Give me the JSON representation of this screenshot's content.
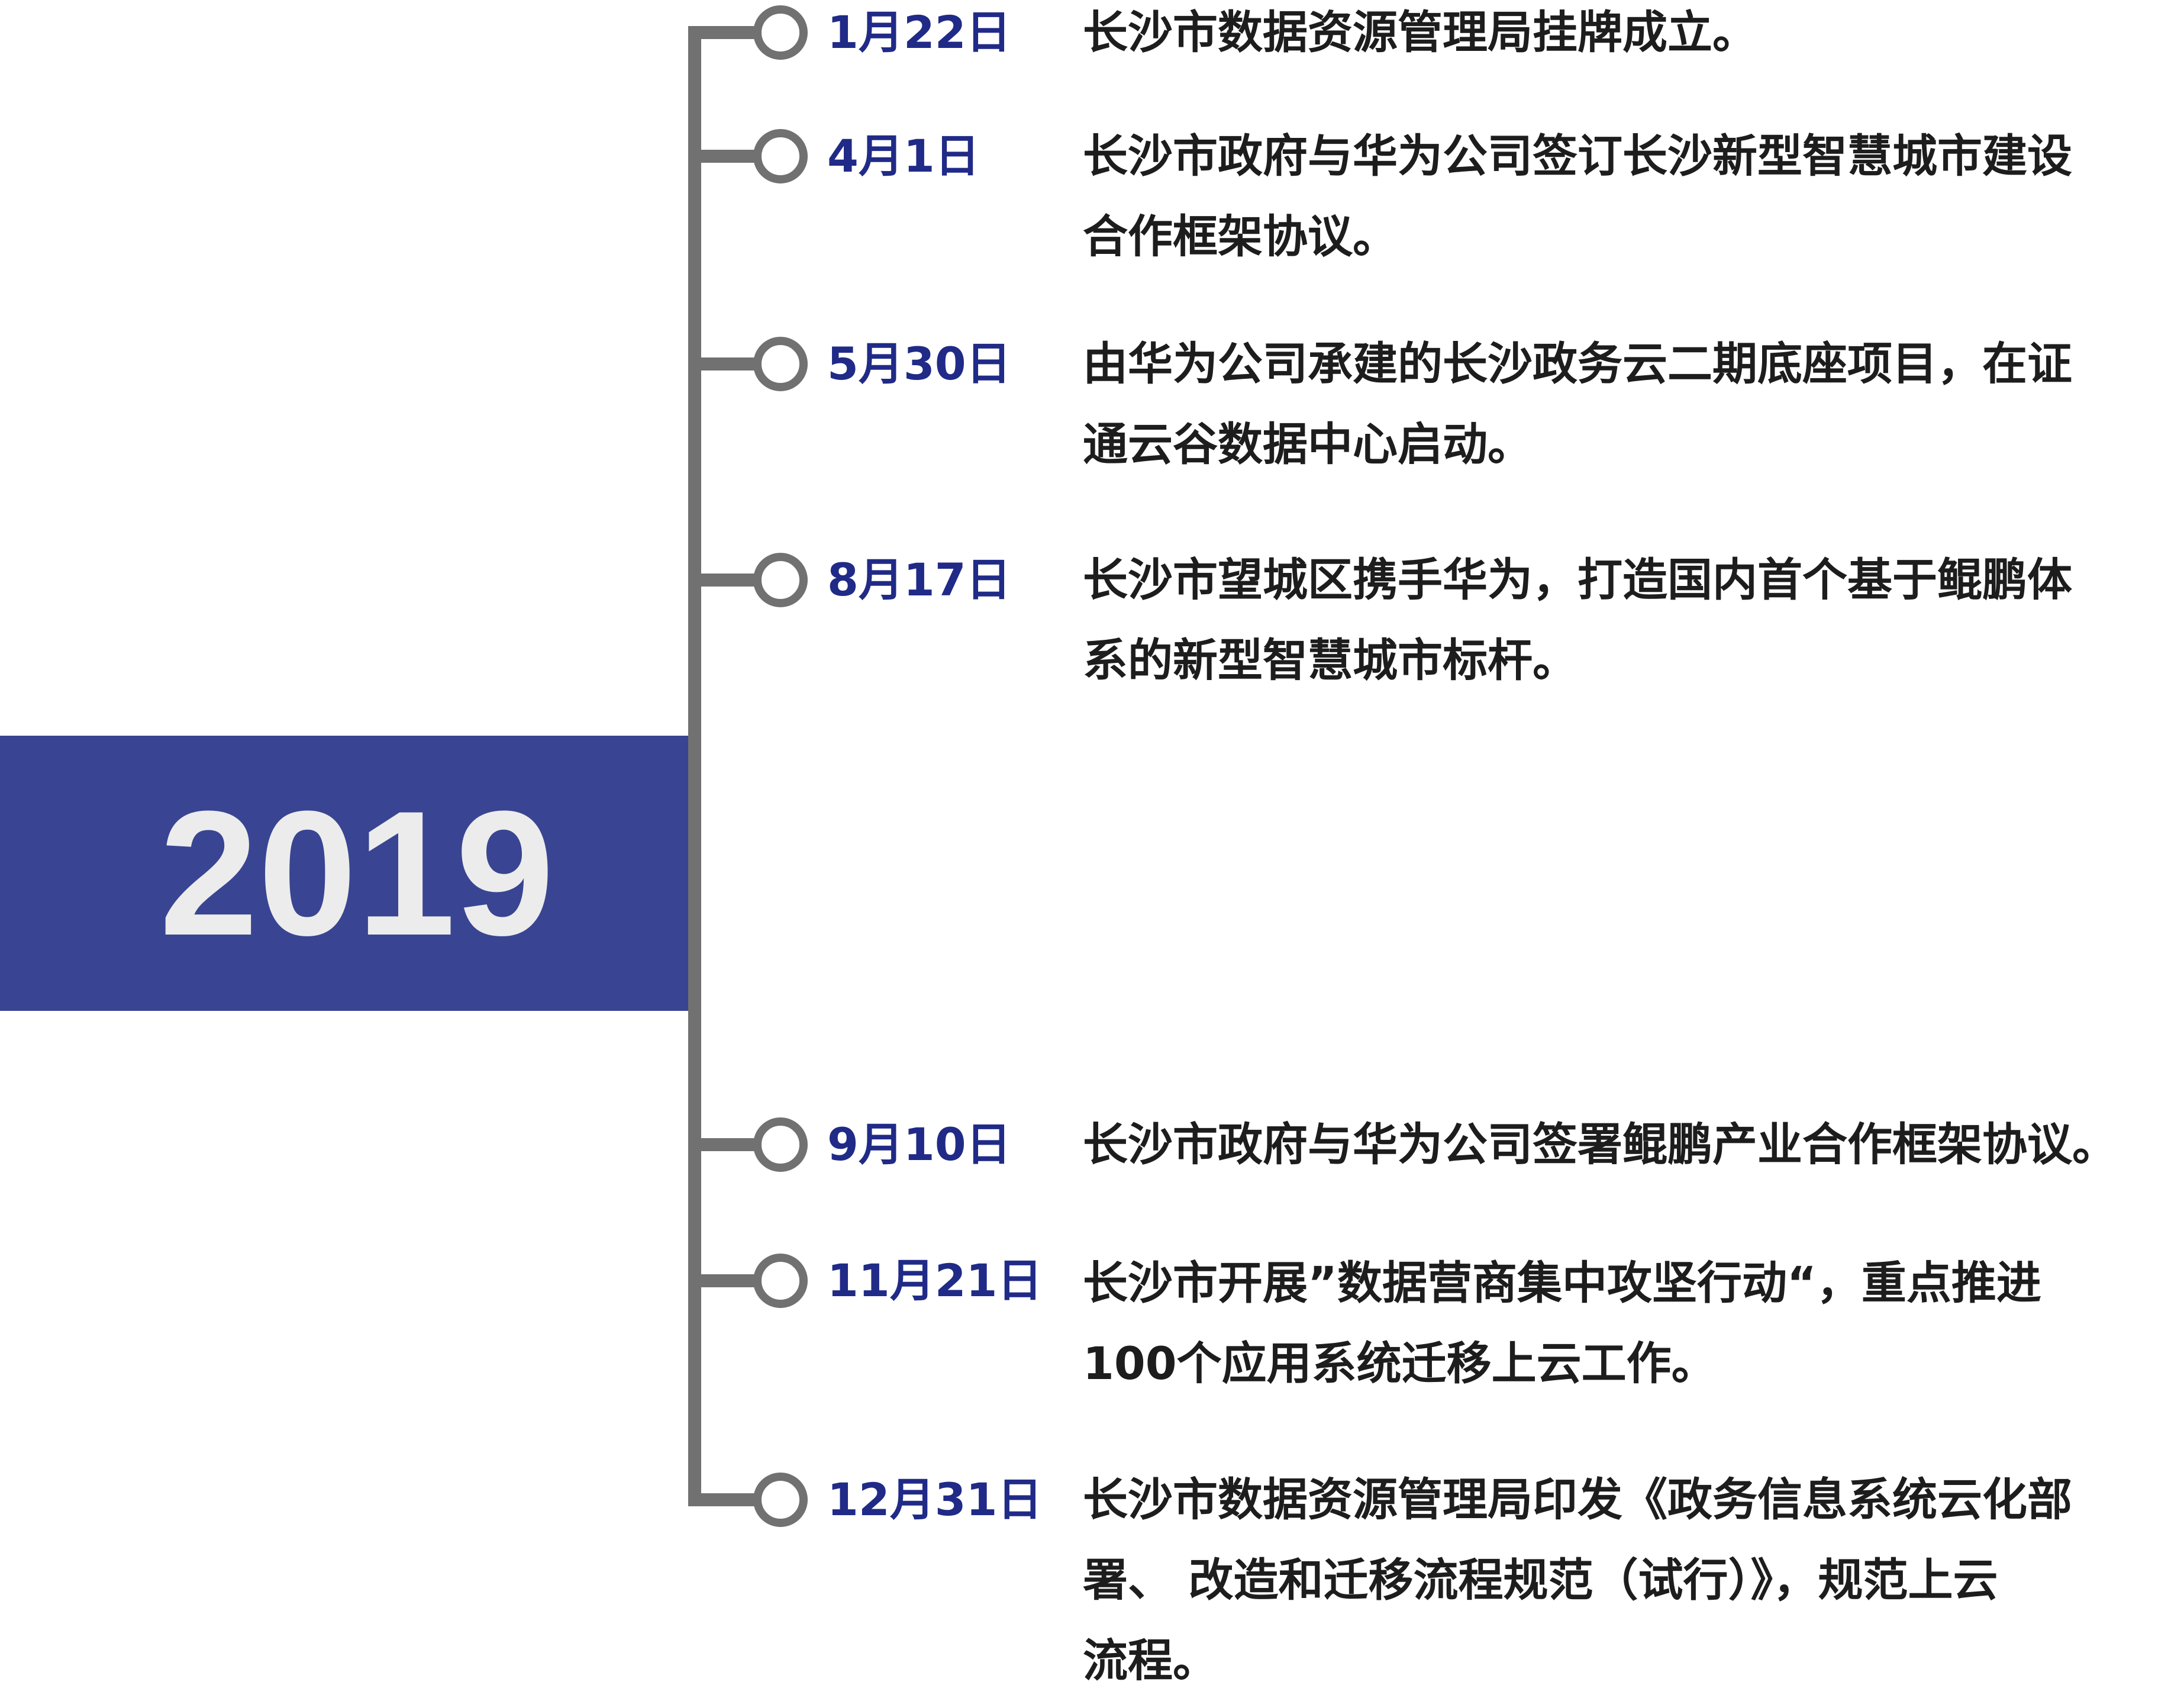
{
  "year": "2019",
  "events": [
    {
      "date": "1月22日",
      "lines": [
        "长沙市数据资源管理局挂牌成立。"
      ]
    },
    {
      "date": "4月1日",
      "lines": [
        "长沙市政府与华为公司签订长沙新型智慧城市建设",
        "合作框架协议。"
      ]
    },
    {
      "date": "5月30日",
      "lines": [
        "由华为公司承建的长沙政务云二期底座项目，在证",
        "通云谷数据中心启动。"
      ]
    },
    {
      "date": "8月17日",
      "lines": [
        "长沙市望城区携手华为，打造国内首个基于鲲鹏体",
        "系的新型智慧城市标杆。"
      ]
    },
    {
      "date": "9月10日",
      "lines": [
        "长沙市政府与华为公司签署鲲鹏产业合作框架协议。"
      ]
    },
    {
      "date": "11月21日",
      "lines": [
        "长沙市开展”数据营商集中攻坚行动“，重点推进",
        "100个应用系统迁移上云工作。"
      ]
    },
    {
      "date": "12月31日",
      "lines": [
        "长沙市数据资源管理局印发《政务信息系统云化部",
        "署、 改造和迁移流程规范（试行）》，规范上云",
        "流程。"
      ]
    }
  ]
}
